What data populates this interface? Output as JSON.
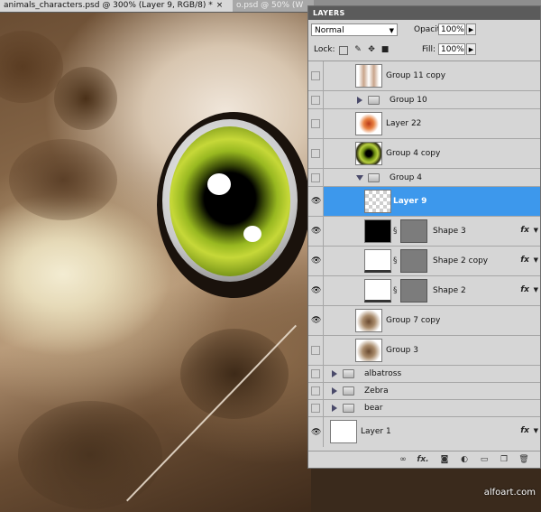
{
  "tabs": [
    {
      "label": "animals_characters.psd @ 300% (Layer 9, RGB/8) *",
      "close": "×"
    },
    {
      "label": "o.psd @ 50% (W"
    }
  ],
  "panel": {
    "title": "LAYERS",
    "blend_mode": "Normal",
    "opacity_label": "Opacity:",
    "opacity_value": "100%",
    "lock_label": "Lock:",
    "fill_label": "Fill:",
    "fill_value": "100%"
  },
  "layers": [
    {
      "name": "Group 11 copy",
      "visible": false,
      "kind": "thumb",
      "thumb": "owl-wings"
    },
    {
      "name": "Group 10",
      "visible": false,
      "kind": "group",
      "expanded": false,
      "indent": 1
    },
    {
      "name": "Layer 22",
      "visible": false,
      "kind": "thumb",
      "thumb": "beak"
    },
    {
      "name": "Group 4 copy",
      "visible": false,
      "kind": "thumb",
      "thumb": "eye"
    },
    {
      "name": "Group 4",
      "visible": false,
      "kind": "group",
      "expanded": true,
      "indent": 1
    },
    {
      "name": "Layer 9",
      "visible": true,
      "kind": "thumb",
      "thumb": "transparent",
      "selected": true
    },
    {
      "name": "Shape 3",
      "visible": true,
      "kind": "shape",
      "fx": "fx"
    },
    {
      "name": "Shape 2 copy",
      "visible": true,
      "kind": "shape",
      "fx": "fx"
    },
    {
      "name": "Shape 2",
      "visible": true,
      "kind": "shape",
      "fx": "fx"
    },
    {
      "name": "Group 7 copy",
      "visible": true,
      "kind": "thumb",
      "thumb": "owl"
    },
    {
      "name": "Group 3",
      "visible": false,
      "kind": "thumb",
      "thumb": "owl"
    },
    {
      "name": "albatross",
      "visible": false,
      "kind": "group",
      "expanded": false,
      "indent": 0
    },
    {
      "name": "Zebra",
      "visible": false,
      "kind": "group",
      "expanded": false,
      "indent": 0
    },
    {
      "name": "bear",
      "visible": false,
      "kind": "group",
      "expanded": false,
      "indent": 0
    },
    {
      "name": "Layer 1",
      "visible": true,
      "kind": "thumb",
      "thumb": "white",
      "fx": "fx"
    }
  ],
  "footer_buttons": [
    "link-icon",
    "fx-icon",
    "mask-icon",
    "adjustment-icon",
    "new-group-icon",
    "new-layer-icon",
    "trash-icon"
  ],
  "watermark": "alfoart.com"
}
